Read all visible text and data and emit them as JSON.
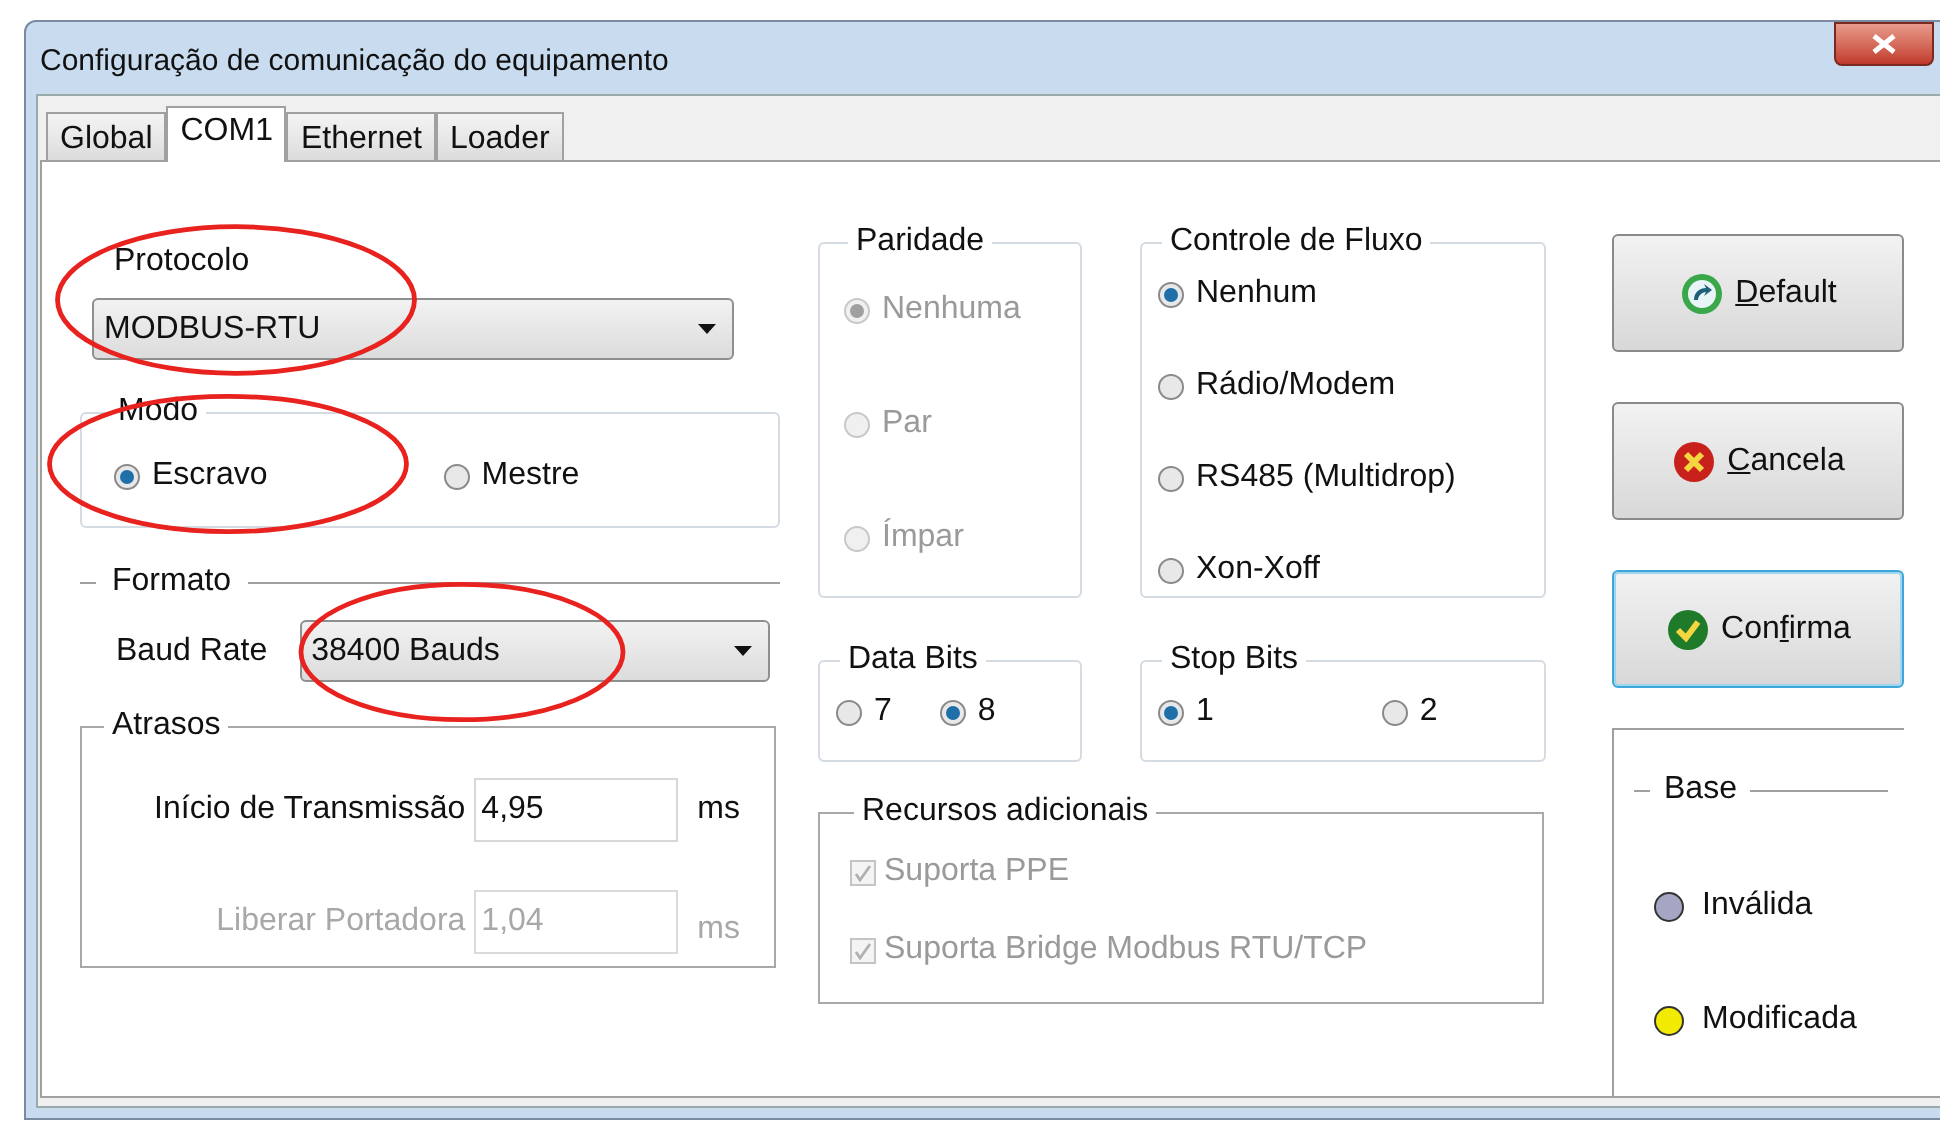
{
  "window": {
    "title": "Configuração de comunicação do equipamento"
  },
  "tabs": [
    {
      "label": "Global",
      "selected": false
    },
    {
      "label": "COM1",
      "selected": true
    },
    {
      "label": "Ethernet",
      "selected": false
    },
    {
      "label": "Loader",
      "selected": false
    }
  ],
  "protocol": {
    "label": "Protocolo",
    "value": "MODBUS-RTU",
    "highlighted": true
  },
  "mode": {
    "legend": "Modo",
    "highlighted": true,
    "options": [
      {
        "label": "Escravo",
        "selected": true
      },
      {
        "label": "Mestre",
        "selected": false
      }
    ]
  },
  "format": {
    "legend": "Formato"
  },
  "baud_rate": {
    "label": "Baud Rate",
    "value": "38400 Bauds",
    "highlighted": true
  },
  "delays": {
    "legend": "Atrasos",
    "fields": [
      {
        "label": "Início de Transmissão",
        "value": "4,95",
        "unit": "ms",
        "disabled": false
      },
      {
        "label": "Liberar Portadora",
        "value": "1,04",
        "unit": "ms",
        "disabled": true
      }
    ]
  },
  "parity": {
    "legend": "Paridade",
    "options": [
      {
        "label": "Nenhuma",
        "selected": true,
        "disabled": true
      },
      {
        "label": "Par",
        "selected": false,
        "disabled": true
      },
      {
        "label": "Ímpar",
        "selected": false,
        "disabled": true
      }
    ]
  },
  "flow_control": {
    "legend": "Controle de Fluxo",
    "options": [
      {
        "label": "Nenhum",
        "selected": true,
        "disabled": false
      },
      {
        "label": "Rádio/Modem",
        "selected": false,
        "disabled": false
      },
      {
        "label": "RS485 (Multidrop)",
        "selected": false,
        "disabled": false
      },
      {
        "label": "Xon-Xoff",
        "selected": false,
        "disabled": false
      }
    ]
  },
  "data_bits": {
    "legend": "Data Bits",
    "options": [
      {
        "label": "7",
        "selected": false,
        "disabled": false
      },
      {
        "label": "8",
        "selected": true,
        "disabled": false
      }
    ]
  },
  "stop_bits": {
    "legend": "Stop Bits",
    "options": [
      {
        "label": "1",
        "selected": true,
        "disabled": false
      },
      {
        "label": "2",
        "selected": false,
        "disabled": false
      }
    ]
  },
  "additional": {
    "legend": "Recursos adicionais",
    "options": [
      {
        "label": "Suporta PPE",
        "checked": true,
        "disabled": true
      },
      {
        "label": "Suporta Bridge Modbus RTU/TCP",
        "checked": true,
        "disabled": true
      }
    ]
  },
  "buttons": [
    {
      "kind": "default",
      "key": "D",
      "after": "efault",
      "focused": false
    },
    {
      "kind": "cancel",
      "key": "C",
      "after": "ancela",
      "focused": false
    },
    {
      "kind": "confirm",
      "before": "Con",
      "key": "f",
      "after": "irma",
      "focused": true
    }
  ],
  "status_legend": {
    "title": "Base",
    "items": [
      {
        "label": "Inválida",
        "color": "#a4a6c4"
      },
      {
        "label": "Modificada",
        "color": "#f2ea00"
      }
    ]
  }
}
